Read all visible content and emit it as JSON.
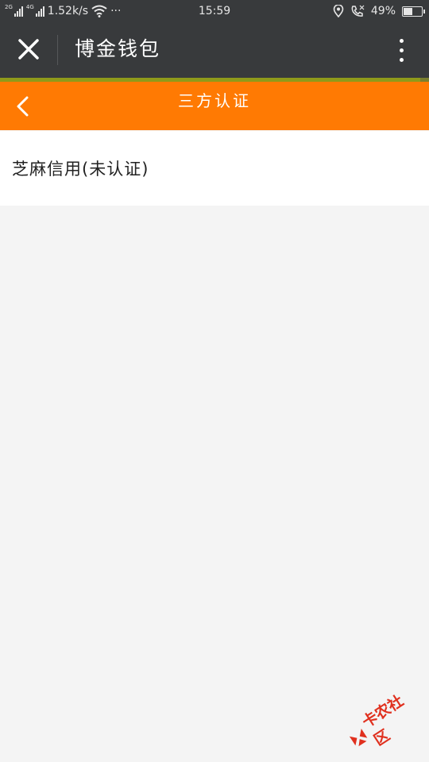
{
  "status_bar": {
    "network_1": "2G",
    "network_2": "4G",
    "speed": "1.52k/s",
    "overflow": "···",
    "time": "15:59",
    "battery": "49%",
    "battery_level": 0.49
  },
  "title_bar": {
    "title": "博金钱包"
  },
  "page_load_progress": 0.98,
  "nav": {
    "title": "三方认证"
  },
  "list": {
    "items": [
      {
        "label": "芝麻信用(未认证)"
      }
    ]
  },
  "watermark": {
    "text": "卡农社区"
  },
  "colors": {
    "status_bar_bg": "#383a3c",
    "nav_bar_bg": "#ff7a03",
    "page_bg": "#f4f4f4",
    "watermark_red": "#e0301e"
  }
}
